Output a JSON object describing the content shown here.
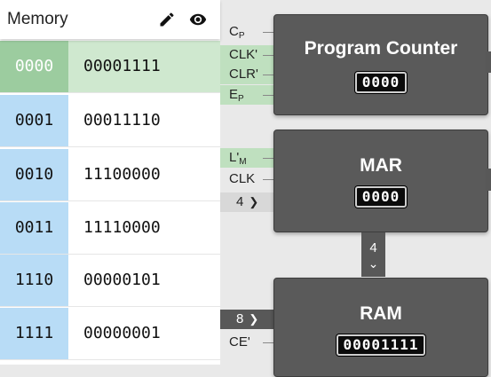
{
  "memory": {
    "title": "Memory",
    "rows": [
      {
        "address": "0000",
        "value": "00001111",
        "active": true
      },
      {
        "address": "0001",
        "value": "00011110",
        "active": false
      },
      {
        "address": "0010",
        "value": "11100000",
        "active": false
      },
      {
        "address": "0011",
        "value": "11110000",
        "active": false
      },
      {
        "address": "1110",
        "value": "00000101",
        "active": false
      },
      {
        "address": "1111",
        "value": "00000001",
        "active": false
      }
    ]
  },
  "program_counter": {
    "title": "Program Counter",
    "display": "0000",
    "signals": {
      "cp": {
        "main": "C",
        "sub": "P"
      },
      "clk": "CLK'",
      "clr": "CLR'",
      "ep": {
        "main": "E",
        "sub": "P"
      }
    }
  },
  "mar": {
    "title": "MAR",
    "display": "0000",
    "signals": {
      "lm": {
        "main": "L'",
        "sub": "M"
      },
      "clk": "CLK"
    },
    "bus_in": "4"
  },
  "bus_mar_ram": "4",
  "ram": {
    "title": "RAM",
    "display": "00001111",
    "bus_out": "8",
    "signals": {
      "ce": "CE'"
    }
  },
  "colors": {
    "active_address": "#9ccc9f",
    "active_value": "#cfe8cf",
    "address_bg": "#b8dcf6",
    "signal_high": "#bfe0bf",
    "component": "#5a5a5a"
  }
}
